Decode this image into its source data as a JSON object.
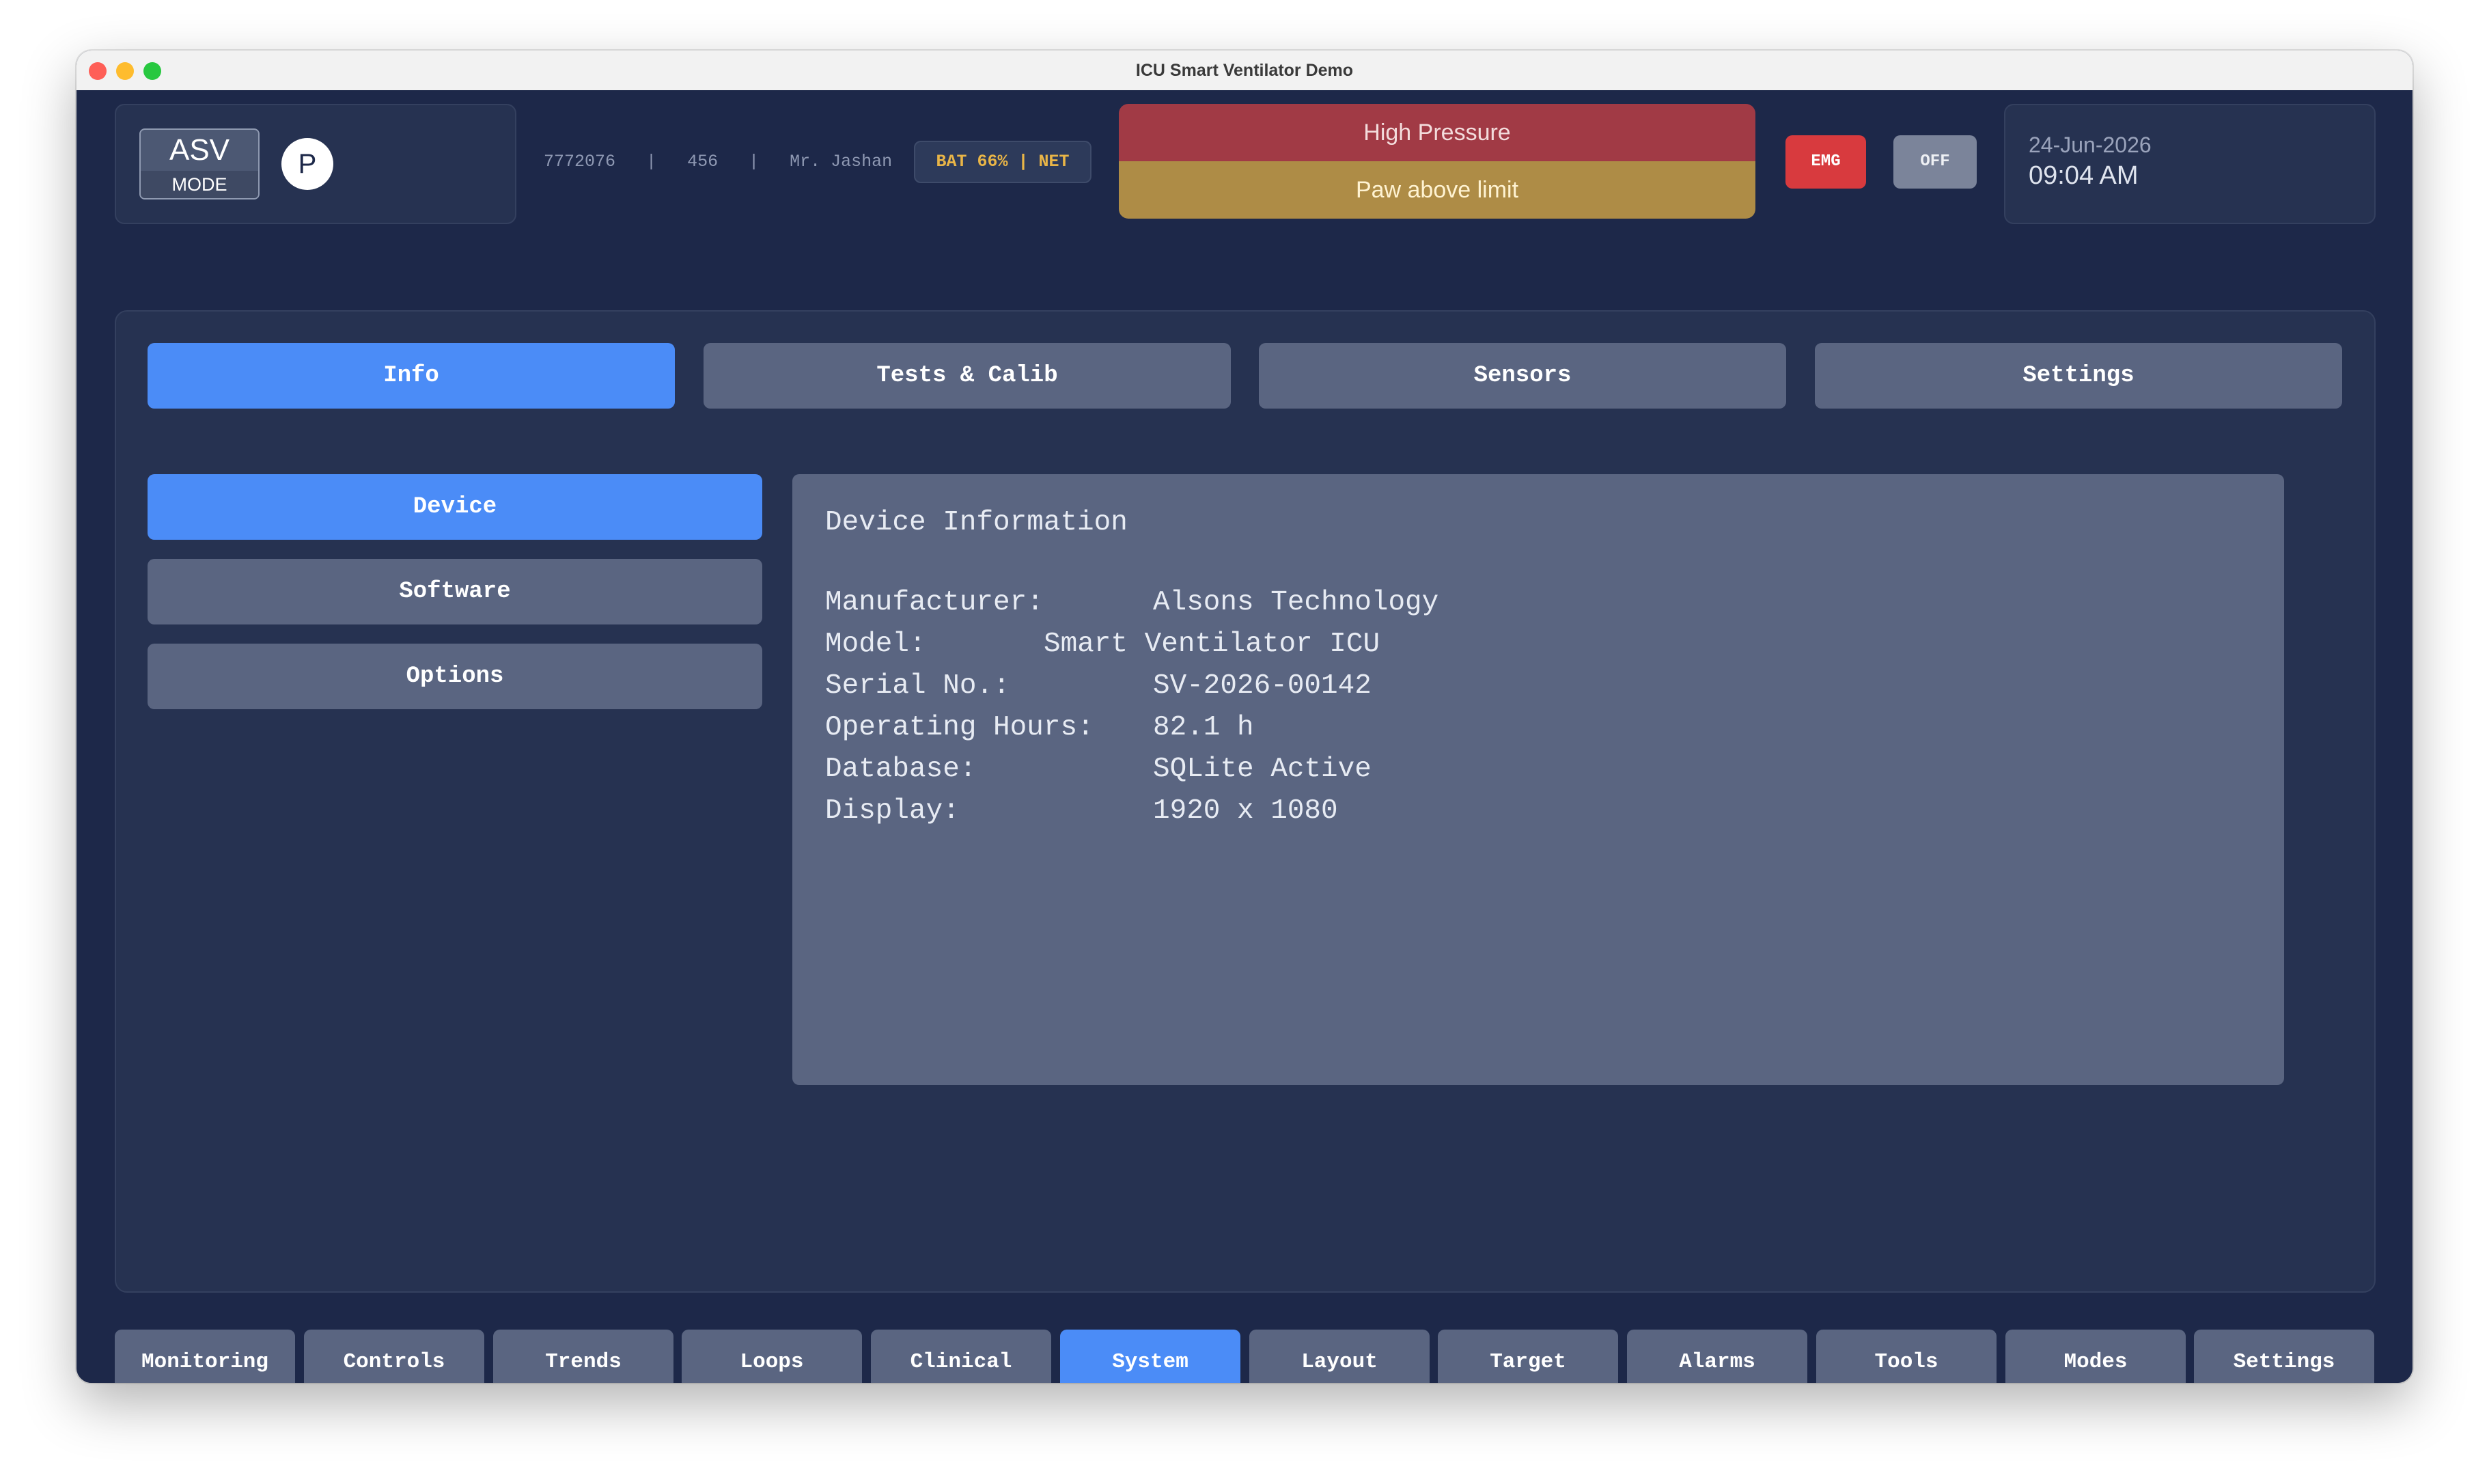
{
  "window": {
    "title": "ICU Smart Ventilator Demo"
  },
  "header": {
    "mode": {
      "value": "ASV",
      "label": "MODE"
    },
    "profile_badge": "P",
    "patient": {
      "id": "7772076",
      "bed": "456",
      "name": "Mr. Jashan",
      "separator": "|"
    },
    "status_badge": "BAT 66% | NET",
    "alarms": [
      {
        "text": "High Pressure",
        "color": "#a13a45"
      },
      {
        "text": "Paw above limit",
        "color": "#ae8c46"
      }
    ],
    "emg_label": "EMG",
    "off_label": "OFF",
    "date": "24-Jun-2026",
    "time": "09:04 AM"
  },
  "top_tabs": [
    {
      "label": "Info",
      "active": true
    },
    {
      "label": "Tests & Calib",
      "active": false
    },
    {
      "label": "Sensors",
      "active": false
    },
    {
      "label": "Settings",
      "active": false
    }
  ],
  "side_menu": [
    {
      "label": "Device",
      "active": true
    },
    {
      "label": "Software",
      "active": false
    },
    {
      "label": "Options",
      "active": false
    }
  ],
  "device_info": {
    "title": "Device Information",
    "rows": [
      {
        "label": "Manufacturer:",
        "value": "Alsons Technology"
      },
      {
        "label": "Model:",
        "value": "Smart Ventilator ICU"
      },
      {
        "label": "Serial No.:",
        "value": "SV-2026-00142"
      },
      {
        "label": "Operating Hours:",
        "value": "82.1 h"
      },
      {
        "label": "Database:",
        "value": "SQLite Active"
      },
      {
        "label": "Display:",
        "value": "1920 x 1080"
      }
    ]
  },
  "bottom_nav": [
    {
      "label": "Monitoring",
      "active": false
    },
    {
      "label": "Controls",
      "active": false
    },
    {
      "label": "Trends",
      "active": false
    },
    {
      "label": "Loops",
      "active": false
    },
    {
      "label": "Clinical",
      "active": false
    },
    {
      "label": "System",
      "active": true
    },
    {
      "label": "Layout",
      "active": false
    },
    {
      "label": "Target",
      "active": false
    },
    {
      "label": "Alarms",
      "active": false
    },
    {
      "label": "Tools",
      "active": false
    },
    {
      "label": "Modes",
      "active": false
    },
    {
      "label": "Settings",
      "active": false
    }
  ],
  "colors": {
    "background": "#1d2849",
    "panel": "#263251",
    "button": "#5a6581",
    "accent_active": "#4b8cf7",
    "emergency": "#d83a3e",
    "battery_text": "#e9b547"
  }
}
